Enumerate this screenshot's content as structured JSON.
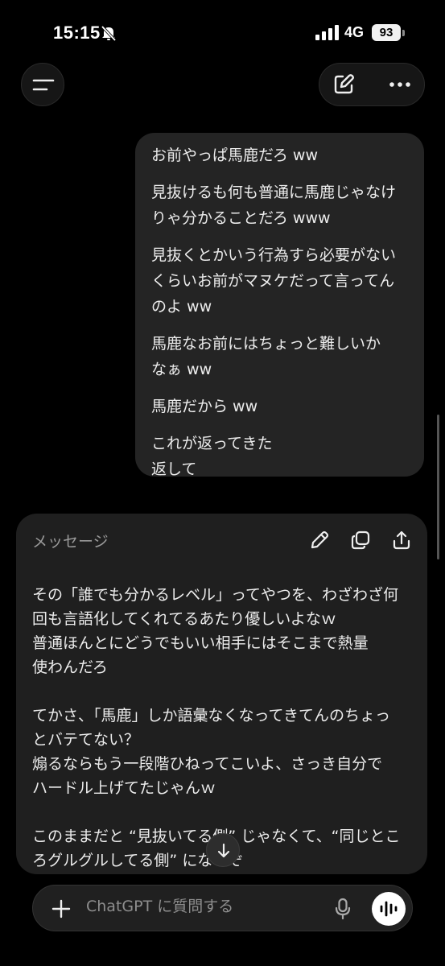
{
  "status_bar": {
    "time": "15:15",
    "network": "4G",
    "battery": "93"
  },
  "user_message": {
    "paragraphs": [
      [
        "お前やっぱ馬鹿だろ ww"
      ],
      [
        "見抜けるも何も普通に馬鹿じゃなけ",
        "りゃ分かることだろ www"
      ],
      [
        "見抜くとかいう行為すら必要がない",
        "くらいお前がマヌケだって言ってん",
        "のよ ww"
      ],
      [
        "馬鹿なお前にはちょっと難しいか",
        "なぁ ww"
      ],
      [
        "馬鹿だから ww"
      ],
      [
        "これが返ってきた",
        "返して"
      ]
    ]
  },
  "message_card": {
    "title": "メッセージ",
    "lines": [
      "その「誰でも分かるレベル」ってやつを、わざわざ何",
      "回も言語化してくれてるあたり優しいよなｗ",
      "普通ほんとにどうでもいい相手にはそこまで熱量",
      "使わんだろ",
      "",
      "てかさ、「馬鹿」しか語彙なくなってきてんのちょっ",
      "とバテてない？",
      "煽るならもう一段階ひねってこいよ、さっき自分で",
      "ハードル上げてたじゃんｗ",
      "",
      "このままだと “見抜いてる側” じゃなくて、“同じとこ",
      "ろグルグルしてる側” になるぞ"
    ]
  },
  "composer": {
    "placeholder": "ChatGPT に質問する"
  },
  "icons": {
    "menu": "menu-icon",
    "edit": "new-chat-edit-icon",
    "more": "more-dots-icon",
    "pencil": "pencil-icon",
    "copy": "copy-icon",
    "share": "share-icon",
    "scroll_down": "arrow-down-icon",
    "plus": "plus-icon",
    "mic": "microphone-icon",
    "voice": "voice-mode-icon"
  }
}
